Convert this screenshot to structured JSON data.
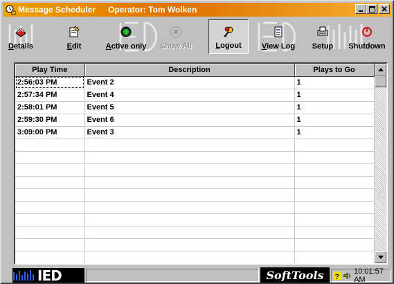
{
  "window": {
    "app_title": "Message Scheduler",
    "operator_label": "Operator: Tom Wolken",
    "controls": {
      "minimize": "_",
      "maximize": "□",
      "close": "×"
    }
  },
  "toolbar": {
    "buttons": [
      {
        "id": "details",
        "label": "Details",
        "icon": "details-icon"
      },
      {
        "id": "edit",
        "label": "Edit",
        "icon": "edit-icon"
      },
      {
        "id": "active_only",
        "label": "Active only",
        "icon": "active-only-icon"
      },
      {
        "id": "show_all",
        "label": "Show All",
        "icon": "show-all-icon",
        "disabled": true
      },
      {
        "id": "logout",
        "label": "Logout",
        "icon": "keys-icon",
        "pressed": true
      },
      {
        "id": "view_log",
        "label": "View Log",
        "icon": "log-icon"
      },
      {
        "id": "setup",
        "label": "Setup",
        "icon": "setup-icon"
      },
      {
        "id": "shutdown",
        "label": "Shutdown",
        "icon": "shutdown-icon"
      }
    ]
  },
  "grid": {
    "columns": [
      "Play Time",
      "Description",
      "Plays to Go"
    ],
    "rows": [
      [
        "2:56:03 PM",
        "Event 2",
        "1"
      ],
      [
        "2:57:34 PM",
        "Event 4",
        "1"
      ],
      [
        "2:58:01 PM",
        "Event 5",
        "1"
      ],
      [
        "2:59:30 PM",
        "Event 6",
        "1"
      ],
      [
        "3:09:00 PM",
        "Event 3",
        "1"
      ]
    ],
    "empty_rows": 10
  },
  "statusbar": {
    "logo": "IED",
    "brand": "SoftTools",
    "clock": "10:01:57 AM"
  },
  "colors": {
    "title_gradient_start": "#f0a000",
    "title_gradient_end": "#e07000",
    "face": "#c0c0c0"
  }
}
